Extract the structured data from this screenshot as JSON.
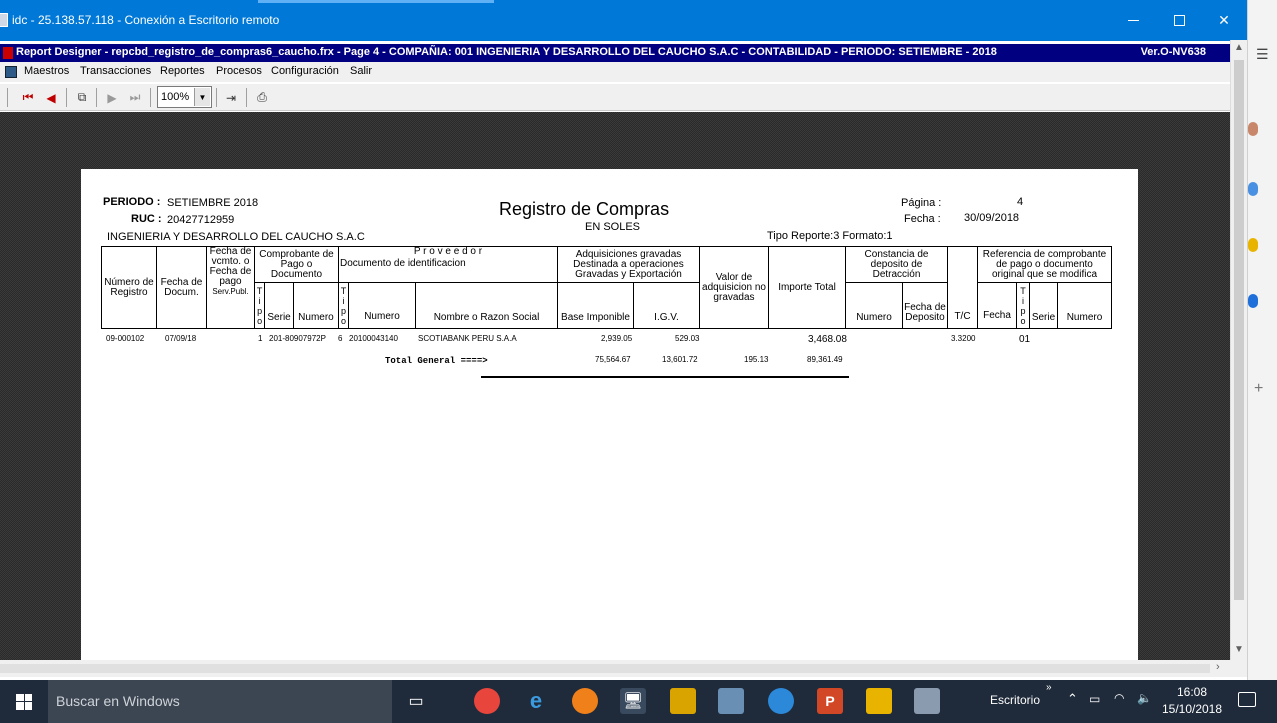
{
  "window": {
    "title": "idc - 25.138.57.118 - Conexión a Escritorio remoto"
  },
  "app": {
    "title": "Report Designer - repcbd_registro_de_compras6_caucho.frx - Page 4 - COMPAÑIA:  001 INGENIERIA Y DESARROLLO DEL CAUCHO S.A.C   -   CONTABILIDAD   -   PERIODO: SETIEMBRE - 2018",
    "version": "Ver.O-NV638"
  },
  "menu": [
    "Maestros",
    "Transacciones",
    "Reportes",
    "Procesos",
    "Configuración",
    "Salir"
  ],
  "toolbar": {
    "zoom": "100%",
    "icons": [
      "first-page-icon",
      "prev-page-icon",
      "copy-icon",
      "next-page-icon",
      "last-page-icon",
      "export-icon",
      "print-icon"
    ]
  },
  "report": {
    "periodo_label": "PERIODO :",
    "periodo": "SETIEMBRE 2018",
    "ruc_label": "RUC :",
    "ruc": "20427712959",
    "company": "INGENIERIA Y DESARROLLO DEL CAUCHO S.A.C",
    "title": "Registro de Compras",
    "subtitle": "EN SOLES",
    "pagina_label": "Página :",
    "pagina": "4",
    "fecha_label": "Fecha :",
    "fecha": "30/09/2018",
    "tipo_reporte": "Tipo Reporte:3 Formato:1",
    "headers": {
      "numero_registro": "Número de Registro",
      "fecha_docum": "Fecha de Docum.",
      "fecha_vcmto": "Fecha de vcmto. o Fecha de pago",
      "serv_publ": "Serv.Publ.",
      "comprobante": "Comprobante de Pago  o Documento",
      "tipo": "Tipo",
      "serie": "Serie",
      "numero": "Numero",
      "proveedor": "P r o v e e d o r",
      "doc_ident": "Documento de identificacion",
      "nombre": "Nombre o Razon Social",
      "adquisiciones": "Adquisiciones gravadas Destinada a operaciones Gravadas y  Exportación",
      "base": "Base Imponible",
      "igv": "I.G.V.",
      "valor_adq": "Valor de adquisicion no gravadas",
      "importe": "Importe Total",
      "constancia": "Constancia de deposito de Detracción",
      "fecha_deposito": "Fecha de Deposito",
      "tc": "T/C",
      "referencia": "Referencia de comprobante de pago o documento original que se modifica",
      "fecha": "Fecha"
    },
    "row": {
      "registro": "09-000102",
      "fecha": "07/09/18",
      "tipo": "1",
      "serie_numero": "201-80907972P",
      "doc_tipo": "6",
      "ruc": "20100043140",
      "nombre": "SCOTIABANK PERU S.A.A",
      "base": "2,939.05",
      "igv": "529.03",
      "importe": "3,468.08",
      "tc": "3.3200",
      "ref_tipo": "01"
    },
    "totals": {
      "label": "Total General  ====>",
      "base": "75,564.67",
      "igv": "13,601.72",
      "valor": "195.13",
      "importe": "89,361.49"
    }
  },
  "taskbar": {
    "search_placeholder": "Buscar en Windows",
    "desktop_label": "Escritorio",
    "time": "16:08",
    "date": "15/10/2018"
  }
}
